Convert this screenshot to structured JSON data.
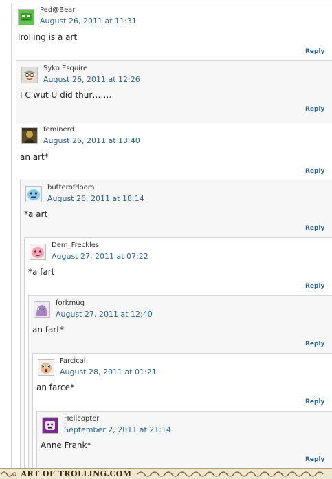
{
  "comments": [
    {
      "author": "Ped@Bear",
      "date": "August 26, 2011 at 11:31",
      "body": "Trolling is a art",
      "reply": "Reply",
      "avatar": "green-robot-face-icon"
    },
    {
      "author": "Syko Esquire",
      "date": "August 26, 2011 at 12:26",
      "body": "I C wut U did thur…….",
      "reply": "Reply",
      "avatar": "glasses-face-icon"
    },
    {
      "author": "feminerd",
      "date": "August 26, 2011 at 13:40",
      "body": "an art*",
      "reply": "Reply",
      "avatar": "dark-photo-avatar-icon"
    },
    {
      "author": "butterofdoom",
      "date": "August 26, 2011 at 18:14",
      "body": "*a art",
      "reply": "Reply",
      "avatar": "blue-blob-face-icon"
    },
    {
      "author": "Dem_Freckles",
      "date": "August 27, 2011 at 07:22",
      "body": "*a fart",
      "reply": "Reply",
      "avatar": "pink-blob-face-icon"
    },
    {
      "author": "forkmug",
      "date": "August 27, 2011 at 12:40",
      "body": "an fart*",
      "reply": "Reply",
      "avatar": "purple-monster-face-icon"
    },
    {
      "author": "Farcical!",
      "date": "August 28, 2011 at 01:21",
      "body": "an farce*",
      "reply": "Reply",
      "avatar": "surprised-face-icon"
    },
    {
      "author": "Helicopter",
      "date": "September 2, 2011 at 21:14",
      "body": "Anne Frank*",
      "reply": "Reply",
      "avatar": "purple-square-face-icon"
    }
  ],
  "watermark": {
    "text": "ART OF TROLLING.COM"
  }
}
